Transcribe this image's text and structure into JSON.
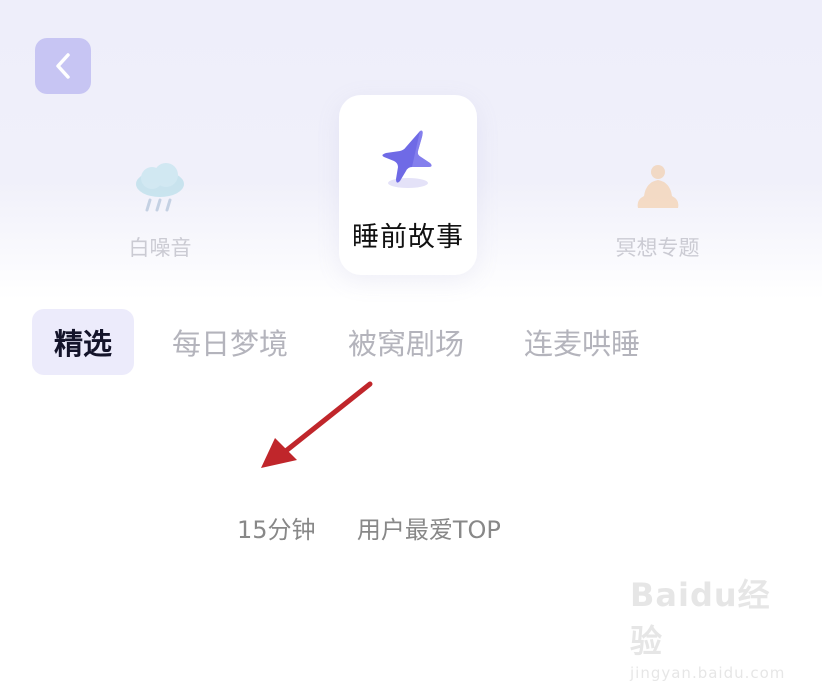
{
  "categories": [
    {
      "label": "白噪音",
      "icon": "rain-cloud-icon",
      "active": false
    },
    {
      "label": "睡前故事",
      "icon": "star-icon",
      "active": true
    },
    {
      "label": "冥想专题",
      "icon": "meditation-icon",
      "active": false
    }
  ],
  "tabs": [
    {
      "label": "精选",
      "active": true
    },
    {
      "label": "每日梦境",
      "active": false
    },
    {
      "label": "被窝剧场",
      "active": false
    },
    {
      "label": "连麦哄睡",
      "active": false
    }
  ],
  "info": {
    "duration": "15分钟",
    "tag": "用户最爱TOP"
  },
  "watermark": {
    "logo": "Baidu经验",
    "url": "jingyan.baidu.com"
  },
  "colors": {
    "accent": "#c7c5f3",
    "active_tab_bg": "#ecebfb",
    "annotation_arrow": "#c0262b"
  }
}
